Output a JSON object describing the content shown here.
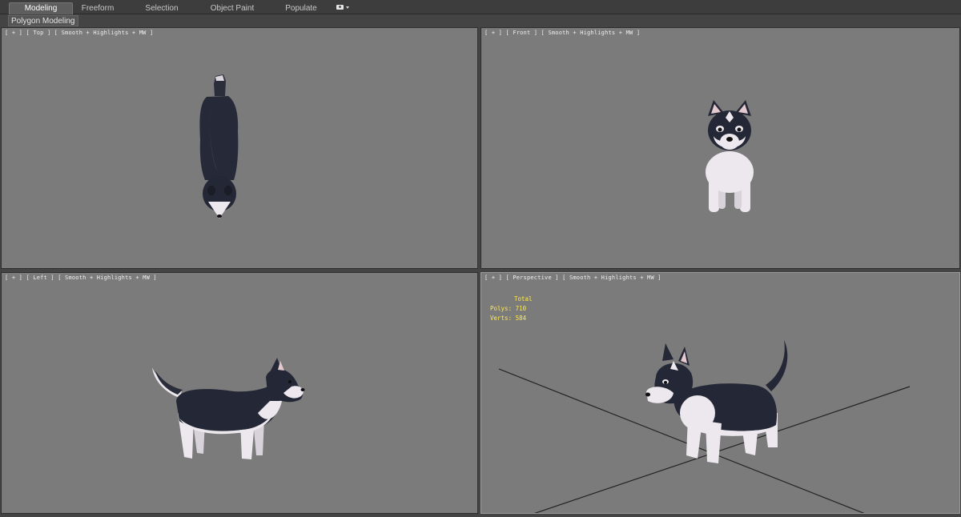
{
  "ribbon": {
    "tabs": [
      {
        "label": "Modeling",
        "active": true
      },
      {
        "label": "Freeform",
        "active": false
      },
      {
        "label": "Selection",
        "active": false
      },
      {
        "label": "Object Paint",
        "active": false
      },
      {
        "label": "Populate",
        "active": false
      }
    ],
    "options_icon": "camera-icon"
  },
  "panel": {
    "label": "Polygon Modeling"
  },
  "viewports": {
    "top": {
      "label": "[ + ] [ Top ] [ Smooth + Highlights + MW ]"
    },
    "front": {
      "label": "[ + ] [ Front ] [ Smooth + Highlights + MW ]"
    },
    "left": {
      "label": "[ + ] [ Left ] [ Smooth + Highlights + MW ]"
    },
    "perspective": {
      "label": "[ + ] [ Perspective ] [ Smooth + Highlights + MW ]"
    }
  },
  "stats": {
    "header": "Total",
    "polys_label": "Polys:",
    "polys_value": "710",
    "verts_label": "Verts:",
    "verts_value": "584",
    "color": "#ffe94a"
  },
  "colors": {
    "viewport_bg": "#7b7b7b",
    "ui_bg": "#444444",
    "fur_dark": "#232634",
    "fur_light": "#ece8ee"
  }
}
